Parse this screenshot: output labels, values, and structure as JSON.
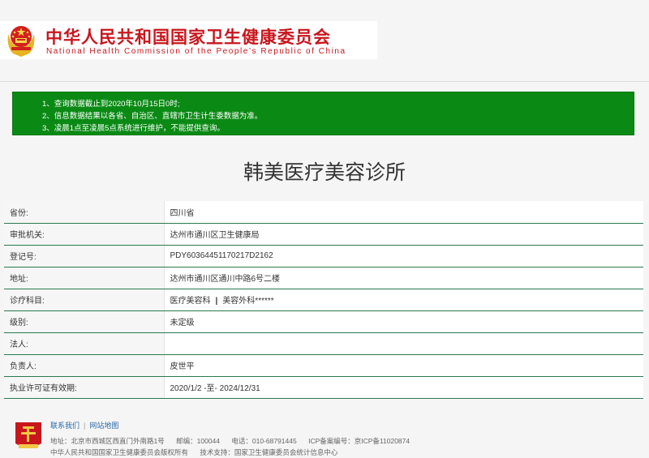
{
  "header": {
    "title_cn": "中华人民共和国国家卫生健康委员会",
    "title_en": "National Health Commission of the People’s Republic of China",
    "emblem_icon": "national-emblem-icon",
    "title_color": "#c8161d"
  },
  "notice": {
    "background_color": "#0a8a14",
    "lines": [
      "1、查询数据截止到2020年10月15日0时;",
      "2、信息数据结果以各省、自治区、直辖市卫生计生委数据为准。",
      "3、凌晨1点至凌晨5点系统进行维护，不能提供查询。"
    ]
  },
  "clinic": {
    "name": "韩美医疗美容诊所"
  },
  "details": [
    {
      "label": "省份:",
      "value": "四川省"
    },
    {
      "label": "审批机关:",
      "value": "达州市通川区卫生健康局"
    },
    {
      "label": "登记号:",
      "value": "PDY60364451170217D2162"
    },
    {
      "label": "地址:",
      "value": "达州市通川区通川中路6号二楼"
    },
    {
      "label": "诊疗科目:",
      "value_a": "医疗美容科",
      "separator": "|",
      "value_b": "美容外科******"
    },
    {
      "label": "级别:",
      "value": "未定级"
    },
    {
      "label": "法人:",
      "value": ""
    },
    {
      "label": "负责人:",
      "value": "皮世平"
    },
    {
      "label": "执业许可证有效期:",
      "value": "2020/1/2 -至- 2024/12/31"
    }
  ],
  "footer": {
    "emblem_icon": "party-emblem-icon",
    "links": [
      "联系我们",
      "网站地图"
    ],
    "link_divider": "|",
    "address": "地址：北京市西城区西直门外南路1号",
    "postcode": "邮编：100044",
    "phone": "电话：010-68791445",
    "icp": "ICP备案编号：京ICP备11020874",
    "copyright": "中华人民共和国国家卫生健康委员会版权所有",
    "tech_support": "技术支持：国家卫生健康委员会统计信息中心"
  }
}
